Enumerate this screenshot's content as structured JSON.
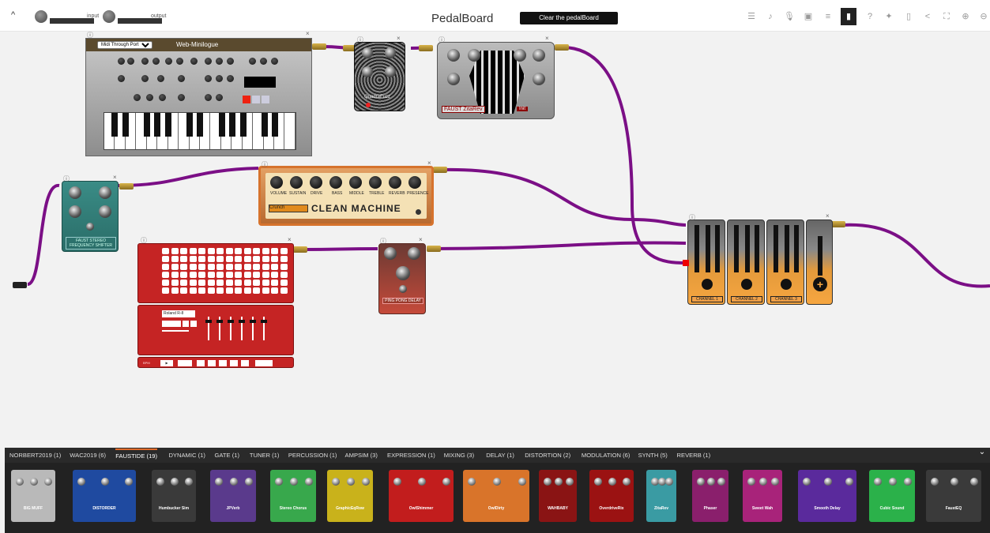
{
  "header": {
    "collapse_glyph": "^",
    "input_label": "input",
    "output_label": "output",
    "title": "PedalBoard",
    "clear_button": "Clear the pedalBoard",
    "toolbar_icons": [
      "mixer-icon",
      "music-note-icon",
      "microphone-icon",
      "save-icon",
      "list-icon",
      "trash-icon",
      "help-icon",
      "puzzle-icon",
      "bookmark-icon",
      "share-icon",
      "fullscreen-icon",
      "zoom-in-icon",
      "zoom-out-icon"
    ]
  },
  "plugins": {
    "minilogue": {
      "name": "Web-Minilogue",
      "midi_select": "Midi Through Port-0"
    },
    "quadrafuzz": {
      "name": "QuadraFuzz"
    },
    "zitarev": {
      "name": "FAUST ZitaRev",
      "preset": "Init"
    },
    "shifter": {
      "name": "FAUST STEREO FREQUENCY SHIFTER"
    },
    "clean": {
      "name": "CLEAN MACHINE",
      "knobs": [
        "VOLUME",
        "SUSTAIN",
        "DRIVE",
        "BASS",
        "MIDDLE",
        "TREBLE",
        "REVERB",
        "PRESENCE"
      ],
      "preset": "Crunch"
    },
    "drums": {
      "kit": "Roland R-8",
      "steps_label": "BPM"
    },
    "pingpong": {
      "name": "PING PONG DELAY"
    },
    "mixer": {
      "channels": [
        "CHANNEL 1",
        "CHANNEL 2",
        "CHANNEL 3"
      ],
      "add_glyph": "+"
    }
  },
  "categories": [
    {
      "label": "NORBERT2019 (1)",
      "active": false
    },
    {
      "label": "WAC2019 (6)",
      "active": false
    },
    {
      "label": "FAUSTIDE (19)",
      "active": true
    },
    {
      "label": "DYNAMIC (1)",
      "active": false
    },
    {
      "label": "GATE (1)",
      "active": false
    },
    {
      "label": "TUNER (1)",
      "active": false
    },
    {
      "label": "PERCUSSION (1)",
      "active": false
    },
    {
      "label": "AMPSIM (3)",
      "active": false
    },
    {
      "label": "EXPRESSION (1)",
      "active": false
    },
    {
      "label": "MIXING (3)",
      "active": false
    },
    {
      "label": "DELAY (1)",
      "active": false
    },
    {
      "label": "DISTORTION (2)",
      "active": false
    },
    {
      "label": "MODULATION (6)",
      "active": false
    },
    {
      "label": "SYNTH (5)",
      "active": false
    },
    {
      "label": "REVERB (1)",
      "active": false
    }
  ],
  "thumbnails": [
    {
      "label": "BIG MUFF",
      "color": "#b9b9b9"
    },
    {
      "label": "DISTORDER",
      "color": "#1f4aa0"
    },
    {
      "label": "Humbucker Sim",
      "color": "#3a3a3a"
    },
    {
      "label": "JPVerb",
      "color": "#5a3a8c"
    },
    {
      "label": "Stereo Chorus",
      "color": "#38a84c"
    },
    {
      "label": "GraphicEqRow",
      "color": "#c9b21b"
    },
    {
      "label": "OwlShimmer",
      "color": "#c21d1d"
    },
    {
      "label": "OwlDirty",
      "color": "#d9742a"
    },
    {
      "label": "WAHBABY",
      "color": "#8a1414"
    },
    {
      "label": "OverdriveRix",
      "color": "#9b1212"
    },
    {
      "label": "ZitaRev",
      "color": "#3a9ba3"
    },
    {
      "label": "Phaser",
      "color": "#8a1f6c"
    },
    {
      "label": "Sweet Wah",
      "color": "#a8237a"
    },
    {
      "label": "Smooth Delay",
      "color": "#5a2a9c"
    },
    {
      "label": "Cubic Sound",
      "color": "#2bb14a"
    },
    {
      "label": "FaustEQ",
      "color": "#3a3a3a"
    }
  ]
}
